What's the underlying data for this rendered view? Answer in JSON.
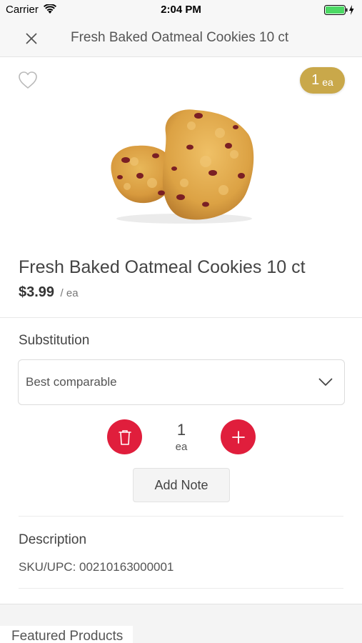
{
  "status_bar": {
    "carrier": "Carrier",
    "time": "2:04 PM",
    "battery_color": "#4cd964"
  },
  "nav": {
    "title": "Fresh Baked Oatmeal Cookies 10 ct",
    "close_icon": "close-icon"
  },
  "cart_badge": {
    "quantity": "1",
    "unit": "ea",
    "color": "#c9a84a"
  },
  "product": {
    "title": "Fresh Baked Oatmeal Cookies 10 ct",
    "price": "$3.99",
    "price_unit": "/ ea",
    "image_description_icon": "cookie-image"
  },
  "substitution": {
    "heading": "Substitution",
    "selected": "Best comparable"
  },
  "stepper": {
    "quantity": "1",
    "unit": "ea",
    "accent_color": "#e01e3c"
  },
  "note": {
    "label": "Add Note"
  },
  "description": {
    "heading": "Description",
    "sku": "SKU/UPC: 00210163000001"
  },
  "featured": {
    "label": "Featured Products"
  }
}
